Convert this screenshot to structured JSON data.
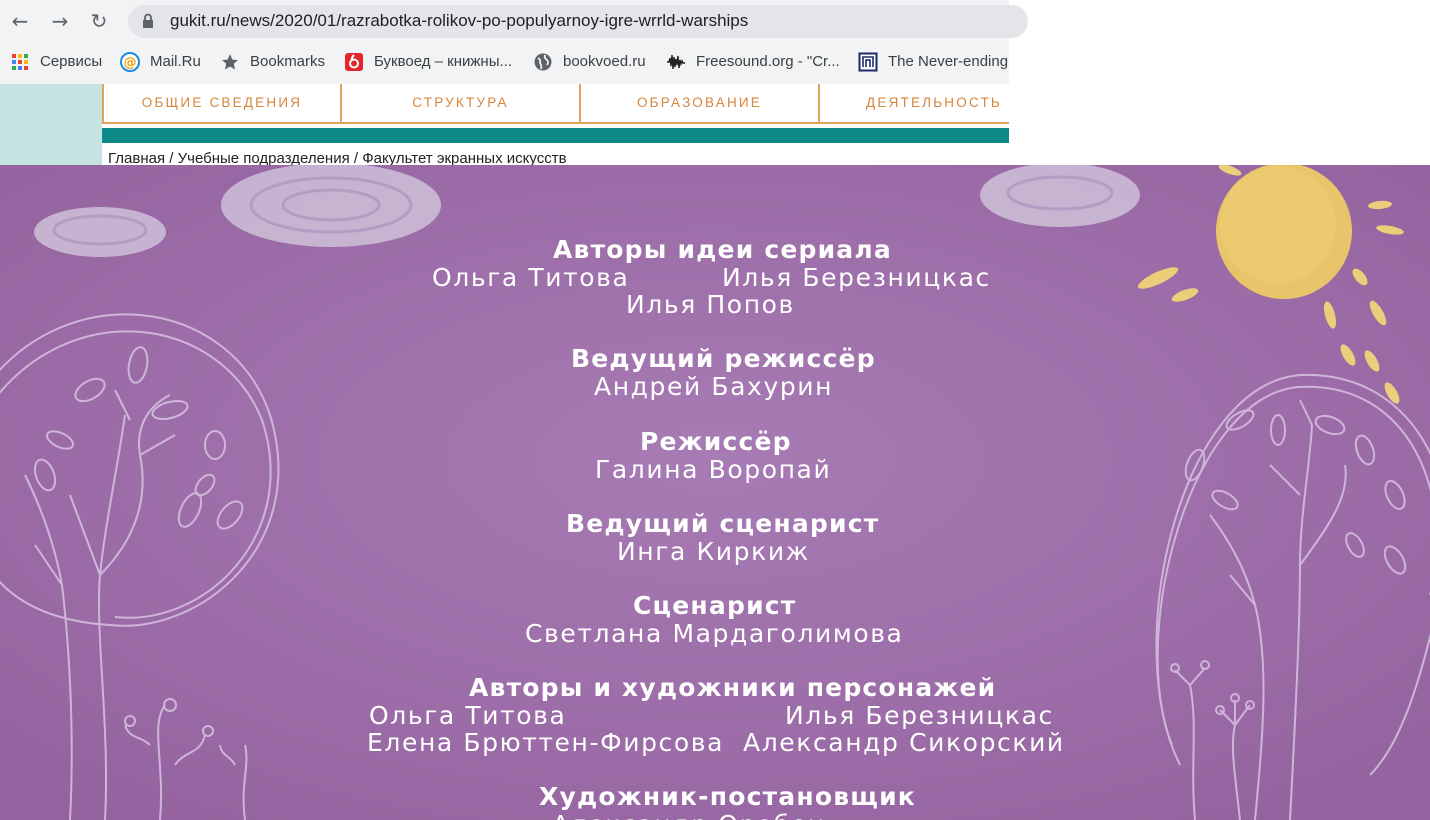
{
  "browser": {
    "url": "gukit.ru/news/2020/01/razrabotka-rolikov-po-populyarnoy-igre-wrrld-warships",
    "bookmarks": [
      {
        "label": "Сервисы",
        "icon": "apps-grid-icon"
      },
      {
        "label": "Mail.Ru",
        "icon": "mailru-at-icon"
      },
      {
        "label": "Bookmarks",
        "icon": "star-icon"
      },
      {
        "label": "Буквоед – книжны...",
        "icon": "bukvoed-icon"
      },
      {
        "label": "bookvoed.ru",
        "icon": "globe-icon"
      },
      {
        "label": "Freesound.org - \"Cr...",
        "icon": "waveform-icon"
      },
      {
        "label": "The Never-ending",
        "icon": "never-ending-icon"
      }
    ]
  },
  "site": {
    "nav": [
      "ОБЩИЕ СВЕДЕНИЯ",
      "СТРУКТУРА",
      "ОБРАЗОВАНИЕ",
      "ДЕЯТЕЛЬНОСТЬ"
    ],
    "breadcrumbs": "Главная / Учебные подразделения / Факультет экранных искусств",
    "colors": {
      "accent": "#d8853b",
      "teal": "#0b8a87",
      "video_bg": "#a778b2"
    }
  },
  "credits": {
    "idea_title": "Авторы идеи сериала",
    "idea_names": [
      "Ольга Титова",
      "Илья Березницкас",
      "Илья Попов"
    ],
    "lead_director_title": "Ведущий режиссёр",
    "lead_director_name": "Андрей Бахурин",
    "director_title": "Режиссёр",
    "director_name": "Галина Воропай",
    "lead_writer_title": "Ведущий сценарист",
    "lead_writer_name": "Инга Киркиж",
    "writer_title": "Сценарист",
    "writer_name": "Светлана Мардаголимова",
    "characters_title": "Авторы и художники персонажей",
    "characters_names": [
      "Ольга Титова",
      "Илья Березницкас",
      "Елена Брюттен-Фирсова",
      "Александр Сикорский"
    ],
    "art_director_title": "Художник-постановщик",
    "art_director_name": "Александр Оробец"
  }
}
